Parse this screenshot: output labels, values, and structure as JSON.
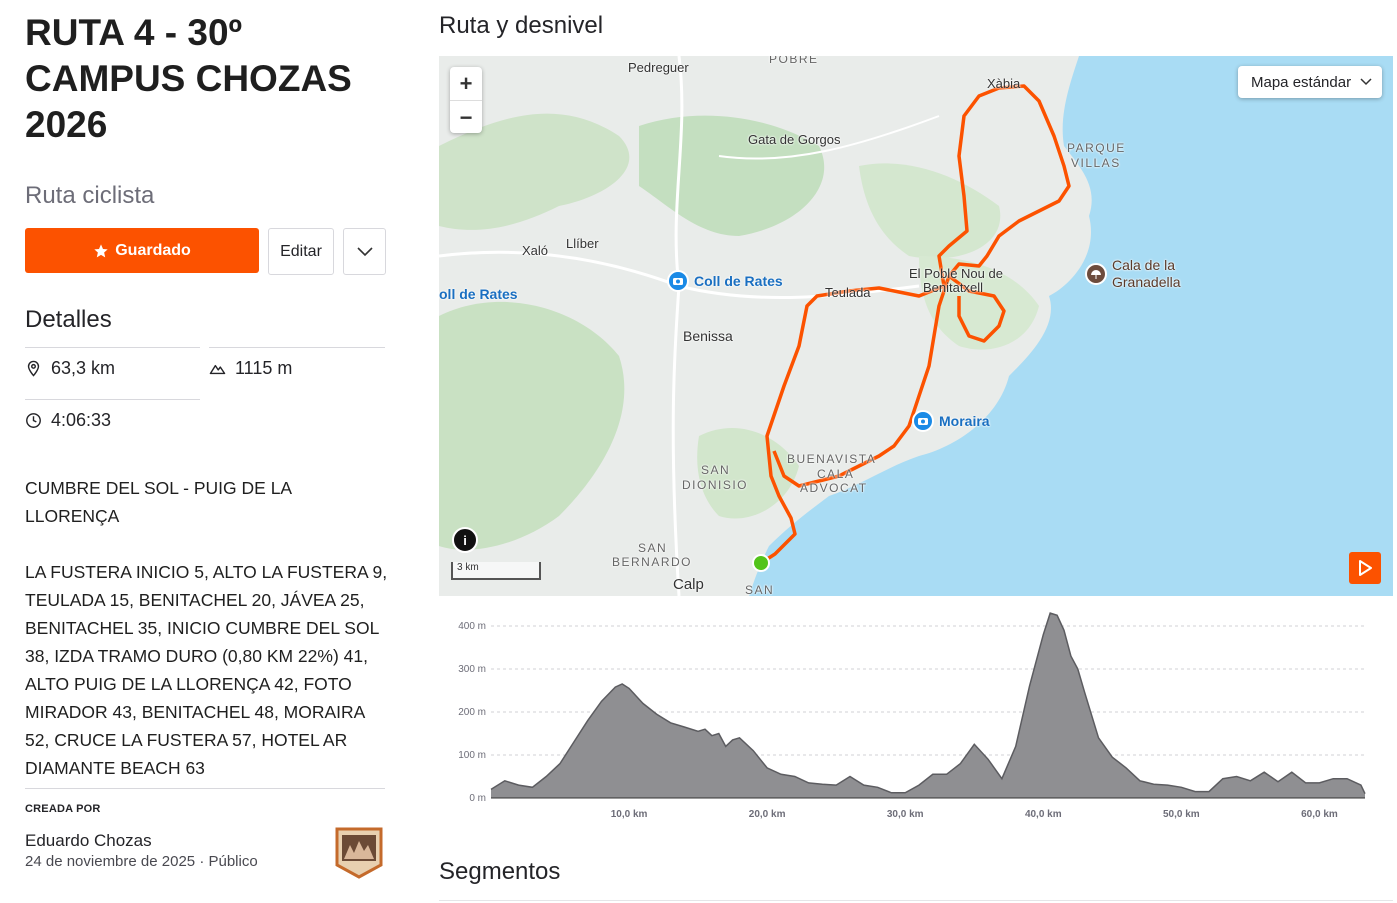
{
  "route": {
    "title": "RUTA 4 - 30º CAMPUS CHOZAS 2026",
    "type_label": "Ruta ciclista"
  },
  "actions": {
    "saved_label": "Guardado",
    "edit_label": "Editar"
  },
  "details": {
    "heading": "Detalles",
    "distance": "63,3 km",
    "elevation": "1115 m",
    "time": "4:06:33"
  },
  "description": "CUMBRE DEL SOL - PUIG DE LA LLORENÇA\n\nLA FUSTERA INICIO 5, ALTO LA FUSTERA 9, TEULADA 15, BENITACHEL 20, JÁVEA 25, BENITACHEL 35, INICIO CUMBRE DEL SOL 38, IZDA TRAMO DURO (0,80 KM 22%) 41, ALTO PUIG DE LA LLORENÇA 42, FOTO MIRADOR 43, BENITACHEL 48, MORAIRA 52, CRUCE LA FUSTERA 57, HOTEL AR DIAMANTE BEACH 63",
  "creator": {
    "label": "CREADA POR",
    "name": "Eduardo Chozas",
    "date": "24 de noviembre de 2025",
    "visibility": "Público"
  },
  "map_section": {
    "heading": "Ruta y desnivel",
    "style_select": "Mapa estándar",
    "scale": "3 km",
    "zoom_in": "+",
    "zoom_out": "−",
    "info": "i",
    "places": {
      "pedreguer": "Pedreguer",
      "pobre": "POBRE",
      "gata": "Gata de Gorgos",
      "xabia": "Xàbia",
      "parque_villas_1": "PARQUE",
      "parque_villas_2": "VILLAS",
      "xalo": "Xaló",
      "lliber": "Llíber",
      "coll_rates_left": "oll de Rates",
      "teulada": "Teulada",
      "poble_nou_1": "El Poble Nou de",
      "poble_nou_2": "Benitatxell",
      "benissa": "Benissa",
      "san_dionisio_1": "SAN",
      "san_dionisio_2": "DIONISIO",
      "buenavista": "BUENAVISTA",
      "cala_advocat_1": "CALA",
      "cala_advocat_2": "ADVOCAT",
      "san_bernardo_1": "SAN",
      "san_bernardo_2": "BERNARDO",
      "calp": "Calp",
      "san_bottom": "SAN"
    },
    "pois": {
      "coll_rates": "Coll de Rates",
      "moraira": "Moraira",
      "granadella_1": "Cala de la",
      "granadella_2": "Granadella"
    },
    "colors": {
      "route": "#fc5200",
      "start_marker": "#52c41a",
      "sea": "#a9dcf4",
      "land": "#e9ecea"
    }
  },
  "elevation_chart": {
    "y_ticks": [
      "400 m",
      "300 m",
      "200 m",
      "100 m",
      "0 m"
    ],
    "x_ticks": [
      "10,0 km",
      "20,0 km",
      "30,0 km",
      "40,0 km",
      "50,0 km",
      "60,0 km"
    ]
  },
  "chart_data": {
    "type": "area",
    "xlabel": "",
    "ylabel": "",
    "xlim": [
      0,
      63.3
    ],
    "ylim": [
      0,
      400
    ],
    "grid": true,
    "x": [
      0,
      1,
      2,
      3,
      4,
      5,
      6,
      7,
      8,
      9,
      9.5,
      10,
      11,
      12,
      13,
      14,
      15,
      15.5,
      16,
      16.5,
      17,
      17.5,
      18,
      19,
      20,
      21,
      22,
      23,
      24,
      25,
      26,
      27,
      28,
      29,
      30,
      31,
      32,
      33,
      34,
      35,
      36,
      37,
      38,
      39,
      40,
      40.5,
      41,
      41.5,
      42,
      42.5,
      43,
      44,
      45,
      46,
      47,
      48,
      49,
      50,
      51,
      52,
      53,
      54,
      55,
      56,
      57,
      58,
      59,
      60,
      61,
      62,
      63,
      63.3
    ],
    "y": [
      20,
      40,
      30,
      25,
      50,
      80,
      130,
      180,
      225,
      258,
      265,
      255,
      220,
      195,
      175,
      165,
      155,
      160,
      145,
      150,
      120,
      135,
      140,
      110,
      70,
      55,
      50,
      35,
      32,
      30,
      50,
      30,
      25,
      12,
      12,
      30,
      55,
      55,
      80,
      125,
      90,
      45,
      120,
      260,
      380,
      430,
      425,
      390,
      330,
      300,
      245,
      140,
      95,
      70,
      40,
      32,
      30,
      25,
      15,
      15,
      45,
      50,
      40,
      60,
      38,
      60,
      35,
      35,
      45,
      45,
      30,
      10
    ]
  }
}
